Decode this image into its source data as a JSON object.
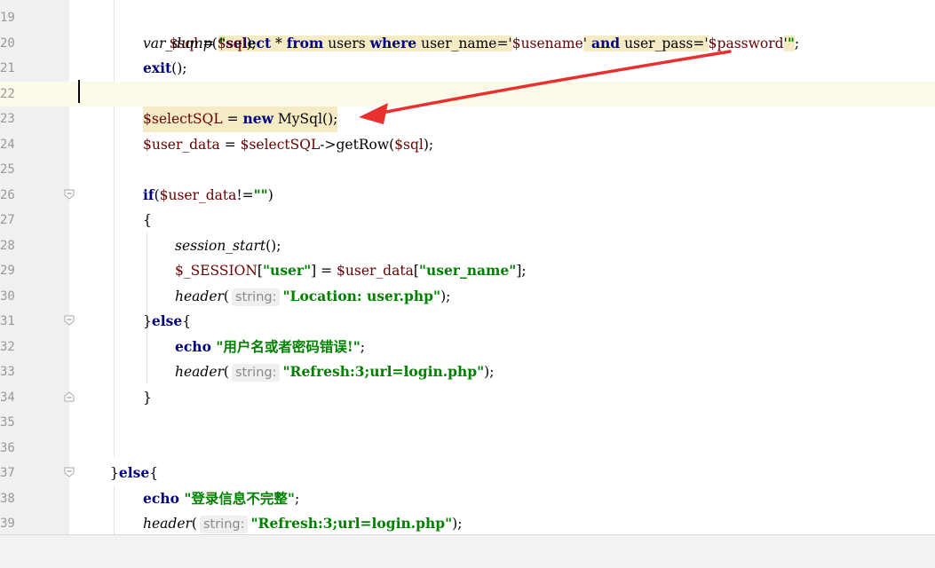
{
  "editor": {
    "line_numbers": [
      "19",
      "20",
      "21",
      "22",
      "23",
      "24",
      "25",
      "26",
      "27",
      "28",
      "29",
      "30",
      "31",
      "32",
      "33",
      "34",
      "35",
      "36",
      "37",
      "38",
      "39"
    ],
    "l19": {
      "v1": "$sql",
      "eq": " = ",
      "q1": "\"",
      "s1": "select",
      "t1": " * ",
      "s2": "from",
      "t2": " users ",
      "s3": "where",
      "t3": " user_name='",
      "v2": "$usename",
      "t4": "' ",
      "s4": "and",
      "t5": " user_pass='",
      "v3": "$password",
      "t6": "'",
      "q2": "\"",
      "end": ";"
    },
    "l20": {
      "fn": "var_dump",
      "p1": "(",
      "v": "$sql",
      "p2": ");"
    },
    "l21": {
      "kw": "exit",
      "rest": "();"
    },
    "l23": {
      "v": "$selectSQL",
      "eq": " = ",
      "kw": "new",
      "cls": " MySql",
      "rest": "();"
    },
    "l24": {
      "v1": "$user_data",
      "eq": " = ",
      "v2": "$selectSQL",
      "arrow": "->",
      "fn": "getRow",
      "p1": "(",
      "v3": "$sql",
      "p2": ");"
    },
    "l26": {
      "kw": "if",
      "p1": "(",
      "v": "$user_data",
      "op": "!=",
      "s": "\"\"",
      "p2": ")"
    },
    "l27": {
      "t": "{"
    },
    "l28": {
      "fn": "session_start",
      "rest": "();"
    },
    "l29": {
      "v": "$_SESSION",
      "b1": "[",
      "s1": "\"user\"",
      "b2": "] = ",
      "v2": "$user_data",
      "b3": "[",
      "s2": "\"user_name\"",
      "b4": "];"
    },
    "l30": {
      "fn": "header",
      "p1": "(",
      "hint": "string:",
      "s": "\"Location: user.php\"",
      "p2": ");"
    },
    "l31": {
      "t1": "}",
      "kw": "else",
      "t2": "{"
    },
    "l32": {
      "kw": "echo",
      "s": " \"用户名或者密码错误!\"",
      "end": ";"
    },
    "l33": {
      "fn": "header",
      "p1": "(",
      "hint": "string:",
      "s": "\"Refresh:3;url=login.php\"",
      "p2": ");"
    },
    "l34": {
      "t": "}"
    },
    "l37": {
      "t1": "}",
      "kw": "else",
      "t2": "{"
    },
    "l38": {
      "kw": "echo",
      "s": " \"登录信息不完整\"",
      "end": ";"
    },
    "l39": {
      "fn": "header",
      "p1": "(",
      "hint": "string:",
      "s": "\"Refresh:3;url=login.php\"",
      "p2": ");"
    }
  },
  "colors": {
    "keyword": "#000080",
    "string": "#008000",
    "variable": "#660000",
    "current_line": "#fcfae9",
    "annotation_arrow": "#e8312f"
  },
  "icons": {
    "fold_open": "fold-open-icon",
    "fold_close": "fold-close-icon",
    "annotation": "red-arrow-annotation-icon"
  }
}
